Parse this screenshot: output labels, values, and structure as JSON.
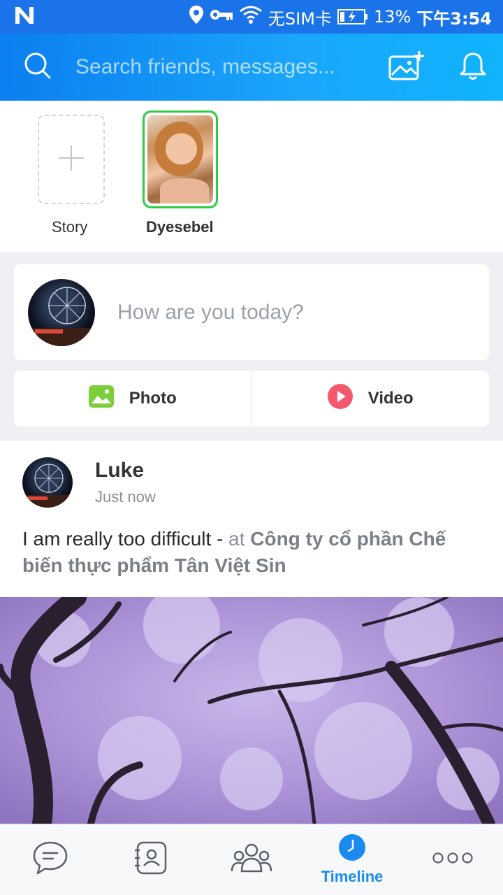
{
  "status_bar": {
    "carrier_text": "无SIM卡",
    "battery_percent": "13%",
    "time": "下午3:54",
    "icons": [
      "n-logo-icon",
      "location-pin-icon",
      "key-icon",
      "wifi-icon",
      "battery-icon"
    ]
  },
  "header": {
    "search_placeholder": "Search friends, messages...",
    "icons": [
      "search-icon",
      "add-photo-icon",
      "bell-icon"
    ]
  },
  "stories": [
    {
      "label": "Story",
      "type": "add"
    },
    {
      "label": "Dyesebel",
      "type": "user"
    }
  ],
  "composer": {
    "placeholder": "How are you today?"
  },
  "media": {
    "photo_label": "Photo",
    "video_label": "Video",
    "photo_color": "#7ccf3b",
    "video_color": "#f5576c"
  },
  "post": {
    "author": "Luke",
    "time": "Just now",
    "text": "I am really too difficult - ",
    "at_text": "at ",
    "place": "Công ty cổ phần Chế biến thực phẩm Tân Việt Sin"
  },
  "bottom_nav": {
    "items": [
      {
        "name": "messages",
        "icon": "chat-icon"
      },
      {
        "name": "contacts",
        "icon": "contacts-icon"
      },
      {
        "name": "groups",
        "icon": "groups-icon"
      },
      {
        "name": "timeline",
        "icon": "clock-icon",
        "label": "Timeline",
        "active": true
      },
      {
        "name": "more",
        "icon": "more-icon"
      }
    ]
  },
  "colors": {
    "accent": "#1a8cf0",
    "story_ring": "#2ecc40"
  }
}
